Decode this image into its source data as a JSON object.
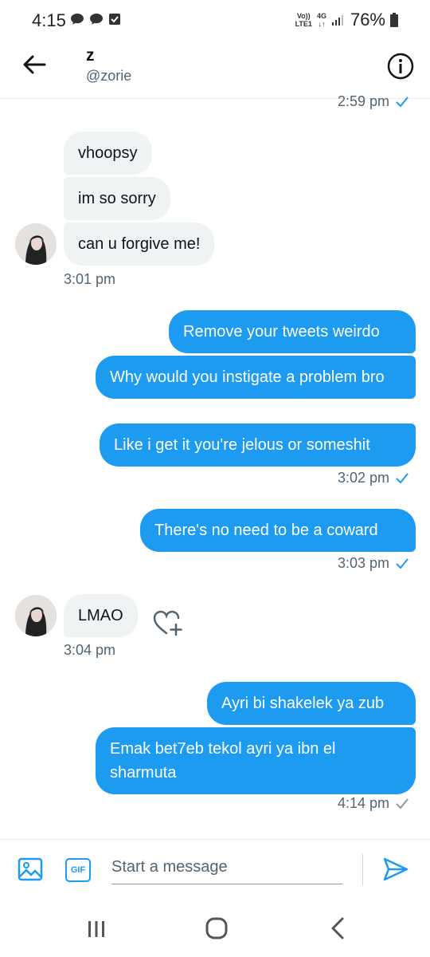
{
  "status_bar": {
    "time": "4:15",
    "network_top": "Vo))",
    "network_bottom": "LTE1",
    "data_top": "4G",
    "data_bottom": "↓↑",
    "battery": "76%"
  },
  "header": {
    "name": "z",
    "handle": "@zorie"
  },
  "thread": {
    "prev_timestamp": "2:59 pm",
    "group1": {
      "messages": [
        "vhoopsy",
        "im so sorry",
        "can u forgive me!"
      ],
      "timestamp": "3:01 pm"
    },
    "group2": {
      "messages": [
        "Remove your tweets weirdo",
        "Why would you instigate a problem bro",
        "Like i get it you're jelous or someshit"
      ],
      "timestamp": "3:02 pm"
    },
    "group3": {
      "messages": [
        "There's no need to be a coward"
      ],
      "timestamp": "3:03 pm"
    },
    "group4": {
      "messages": [
        "LMAO"
      ],
      "timestamp": "3:04 pm"
    },
    "group5": {
      "messages": [
        "Ayri bi shakelek ya zub",
        "Emak bet7eb tekol ayri ya ibn el sharmuta"
      ],
      "timestamp": "4:14 pm"
    }
  },
  "composer": {
    "gif_label": "GIF",
    "placeholder": "Start a message"
  },
  "colors": {
    "accent": "#1d9bf0",
    "received_bubble": "#eff3f4",
    "muted_text": "#536471"
  },
  "icons": {
    "back": "arrow-left-icon",
    "info": "info-icon",
    "react": "heart-plus-icon",
    "media": "image-icon",
    "gif": "gif-icon",
    "send": "send-icon"
  }
}
